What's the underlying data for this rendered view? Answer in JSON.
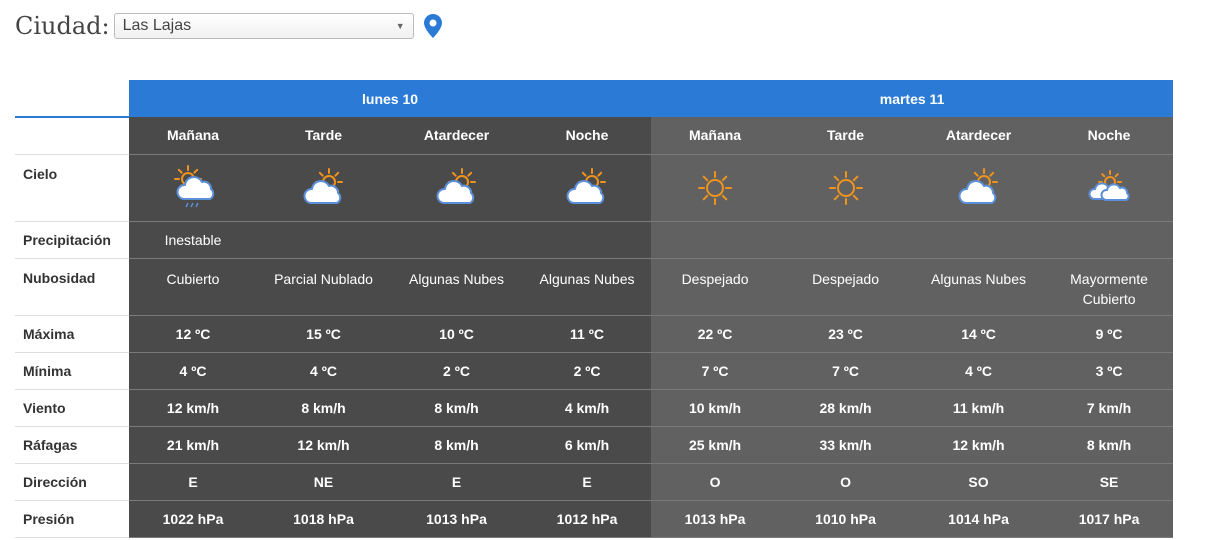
{
  "city": {
    "label": "Ciudad:",
    "selected": "Las Lajas"
  },
  "days": [
    {
      "name": "lunes 10"
    },
    {
      "name": "martes 11"
    }
  ],
  "periods": [
    "Mañana",
    "Tarde",
    "Atardecer",
    "Noche",
    "Mañana",
    "Tarde",
    "Atardecer",
    "Noche"
  ],
  "row_labels": {
    "sky": "Cielo",
    "precip": "Precipitación",
    "cloud": "Nubosidad",
    "max": "Máxima",
    "min": "Mínima",
    "wind": "Viento",
    "gust": "Ráfagas",
    "dir": "Dirección",
    "press": "Presión"
  },
  "sky_icons": [
    "sun-cloud-rain-icon",
    "partly-cloudy-icon",
    "partly-cloudy-icon",
    "partly-cloudy-icon",
    "sun-icon",
    "sun-icon",
    "partly-cloudy-icon",
    "mostly-cloudy-icon"
  ],
  "precip": [
    "Inestable",
    "",
    "",
    "",
    "",
    "",
    "",
    ""
  ],
  "cloud": [
    "Cubierto",
    "Parcial Nublado",
    "Algunas Nubes",
    "Algunas Nubes",
    "Despejado",
    "Despejado",
    "Algunas Nubes",
    "Mayormente Cubierto"
  ],
  "max": [
    "12 ºC",
    "15 ºC",
    "10 ºC",
    "11 ºC",
    "22 ºC",
    "23 ºC",
    "14 ºC",
    "9 ºC"
  ],
  "min": [
    "4 ºC",
    "4 ºC",
    "2 ºC",
    "2 ºC",
    "7 ºC",
    "7 ºC",
    "4 ºC",
    "3 ºC"
  ],
  "wind": [
    "12 km/h",
    "8 km/h",
    "8 km/h",
    "4 km/h",
    "10 km/h",
    "28 km/h",
    "11 km/h",
    "7 km/h"
  ],
  "gust": [
    "21 km/h",
    "12 km/h",
    "8 km/h",
    "6 km/h",
    "25 km/h",
    "33 km/h",
    "12 km/h",
    "8 km/h"
  ],
  "dir": [
    "E",
    "NE",
    "E",
    "E",
    "O",
    "O",
    "SO",
    "SE"
  ],
  "press": [
    "1022 hPa",
    "1018 hPa",
    "1013 hPa",
    "1012 hPa",
    "1013 hPa",
    "1010 hPa",
    "1014 hPa",
    "1017 hPa"
  ],
  "colors": {
    "accent": "#2b7bd6",
    "day1_bg": "#4a4a4a",
    "day2_bg": "#616161",
    "sun": "#f0931e",
    "cloud": "#5b8fd8"
  }
}
